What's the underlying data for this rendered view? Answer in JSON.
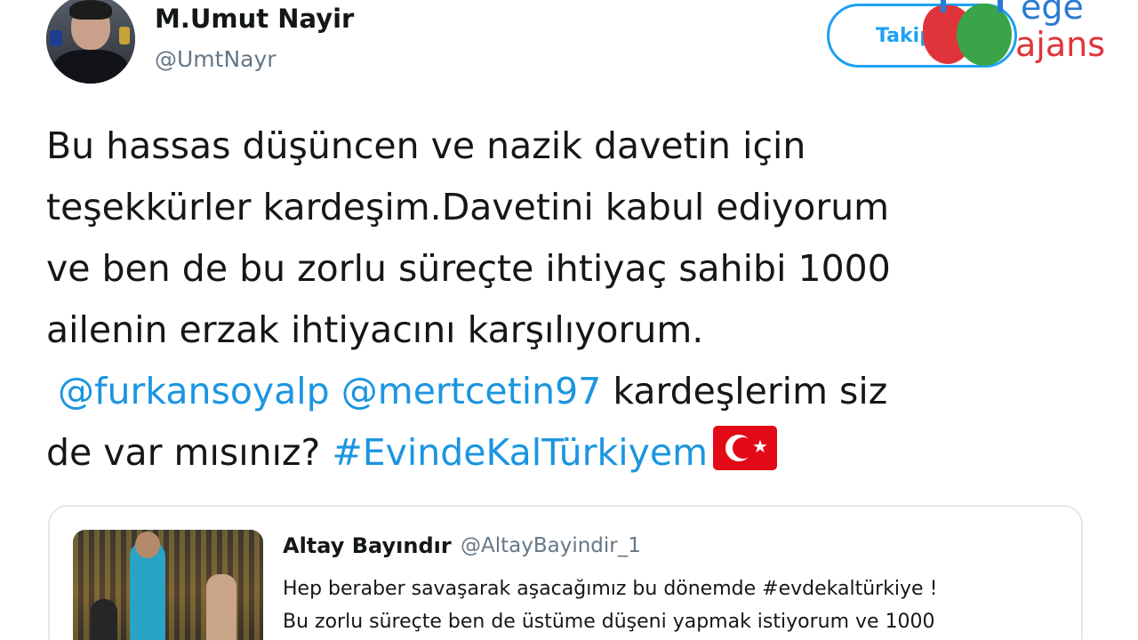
{
  "tweet": {
    "author_name": "M.Umut Nayir",
    "author_handle": "@UmtNayr",
    "follow_label": "Takip et",
    "lines": [
      "Bu hassas düşüncen ve nazik davetin için",
      "teşekkürler kardeşim.Davetini kabul ediyorum",
      "ve ben de bu zorlu süreçte ihtiyaç sahibi 1000",
      "ailenin erzak ihtiyacını karşılıyorum."
    ],
    "mention_1": "@furkansoyalp",
    "mention_2": "@mertcetin97",
    "after_mentions": "kardeşlerim siz",
    "line6_prefix": "de var mısınız?",
    "hashtag": "#EvindeKalTürkiyem"
  },
  "quoted_tweet": {
    "author_name": "Altay Bayındır",
    "author_handle": "@AltayBayindir_1",
    "lines": [
      "Hep beraber savaşarak aşacağımız bu dönemde #evdekaltürkiye !",
      "Bu zorlu süreçte ben de üstüme düşeni yapmak istiyorum ve 1000"
    ]
  },
  "watermark": {
    "top": "ege",
    "bottom": "ajans"
  },
  "colors": {
    "link": "#1b95e0",
    "follow_border": "#1da1f2",
    "secondary_text": "#657786",
    "flag_red": "#e30a17"
  }
}
